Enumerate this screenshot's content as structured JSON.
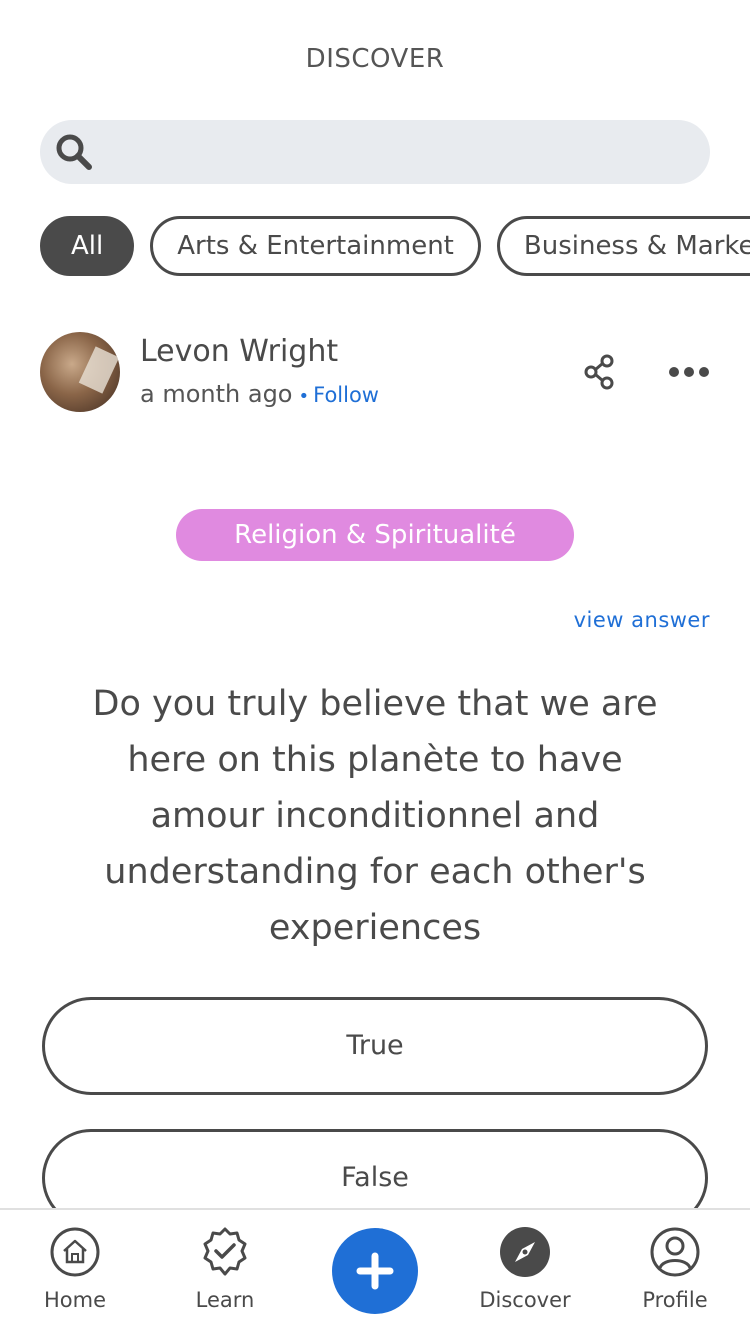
{
  "header": {
    "title": "DISCOVER"
  },
  "search": {
    "placeholder": ""
  },
  "chips": [
    "All",
    "Arts & Entertainment",
    "Business & Marke"
  ],
  "post": {
    "author": "Levon Wright",
    "time": "a month ago",
    "follow": "Follow",
    "category": "Religion & Spiritualité",
    "view_answer": "view answer",
    "question": "Do you truly believe that we are here on this planète to have amour inconditionnel and understanding for each other's experiences",
    "answers": [
      "True",
      "False"
    ]
  },
  "tabbar": {
    "items": [
      {
        "label": "Home",
        "icon": "home-icon"
      },
      {
        "label": "Learn",
        "icon": "learn-badge-icon"
      },
      {
        "label": "",
        "icon": "plus-icon"
      },
      {
        "label": "Discover",
        "icon": "compass-icon"
      },
      {
        "label": "Profile",
        "icon": "profile-icon"
      }
    ]
  },
  "colors": {
    "accent": "#1f6fd6",
    "category_pill": "#e08ae0",
    "text": "#4a4a4a",
    "search_bg": "#e8ebef"
  }
}
